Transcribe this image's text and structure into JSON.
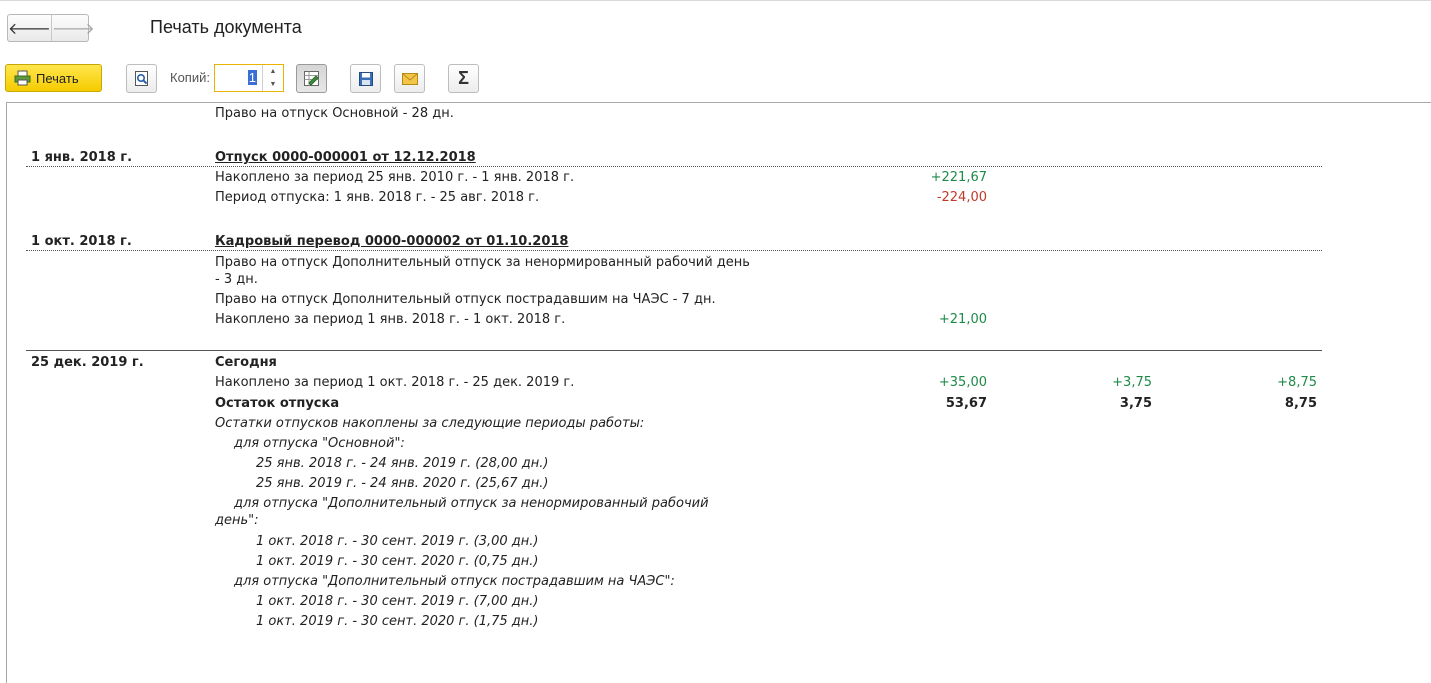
{
  "header": {
    "title": "Печать документа",
    "back_glyph": "🡐",
    "forward_glyph": "🡒"
  },
  "toolbar": {
    "print_label": "Печать",
    "copies_label": "Копий:",
    "copies_value": "1",
    "icons": [
      "printer-icon",
      "preview-icon",
      "edit-icon",
      "save-icon",
      "mail-icon",
      "sum-icon"
    ]
  },
  "doc": {
    "r0": "Право на отпуск Основной - 28 дн.",
    "s1": {
      "date": "1 янв. 2018 г.",
      "title": "Отпуск 0000-000001 от 12.12.2018",
      "l1": "Накоплено за период 25 янв. 2010 г. - 1 янв. 2018 г.",
      "v1": "+221,67",
      "l2": "Период отпуска: 1 янв. 2018 г. - 25 авг. 2018 г.",
      "v2": "-224,00"
    },
    "s2": {
      "date": "1 окт. 2018 г.",
      "title": "Кадровый перевод 0000-000002 от 01.10.2018",
      "l1a": "Право на отпуск Дополнительный отпуск за ненормированный рабочий день",
      "l1b": "- 3 дн.",
      "l2": "Право на отпуск Дополнительный отпуск пострадавшим на ЧАЭС - 7 дн.",
      "l3": "Накоплено за период 1 янв. 2018 г. - 1 окт. 2018 г.",
      "v3": "+21,00"
    },
    "s3": {
      "date": "25 дек. 2019 г.",
      "title": "Сегодня",
      "l1": "Накоплено за период 1 окт. 2018 г. - 25 дек. 2019 г.",
      "v1a": "+35,00",
      "v1b": "+3,75",
      "v1c": "+8,75",
      "l2": "Остаток отпуска",
      "v2a": "53,67",
      "v2b": "3,75",
      "v2c": "8,75"
    },
    "notes": {
      "n0": "Остатки отпусков накоплены за следующие периоды работы:",
      "n1": "для отпуска \"Основной\":",
      "n2": "25 янв. 2018 г. - 24 янв. 2019 г. (28,00 дн.)",
      "n3": "25 янв. 2019 г. - 24 янв. 2020 г. (25,67 дн.)",
      "n4": "для отпуска \"Дополнительный отпуск за ненормированный рабочий",
      "n5": "день\":",
      "n6": "1 окт. 2018 г. - 30 сент. 2019 г. (3,00 дн.)",
      "n7": "1 окт. 2019 г. - 30 сент. 2020 г. (0,75 дн.)",
      "n8": "для отпуска \"Дополнительный отпуск пострадавшим на ЧАЭС\":",
      "n9": "1 окт. 2018 г. - 30 сент. 2019 г. (7,00 дн.)",
      "n10": "1 окт. 2019 г. - 30 сент. 2020 г. (1,75 дн.)"
    }
  },
  "colors": {
    "positive": "#1e8a49",
    "negative": "#c0392b",
    "accent": "#f5cc00"
  }
}
